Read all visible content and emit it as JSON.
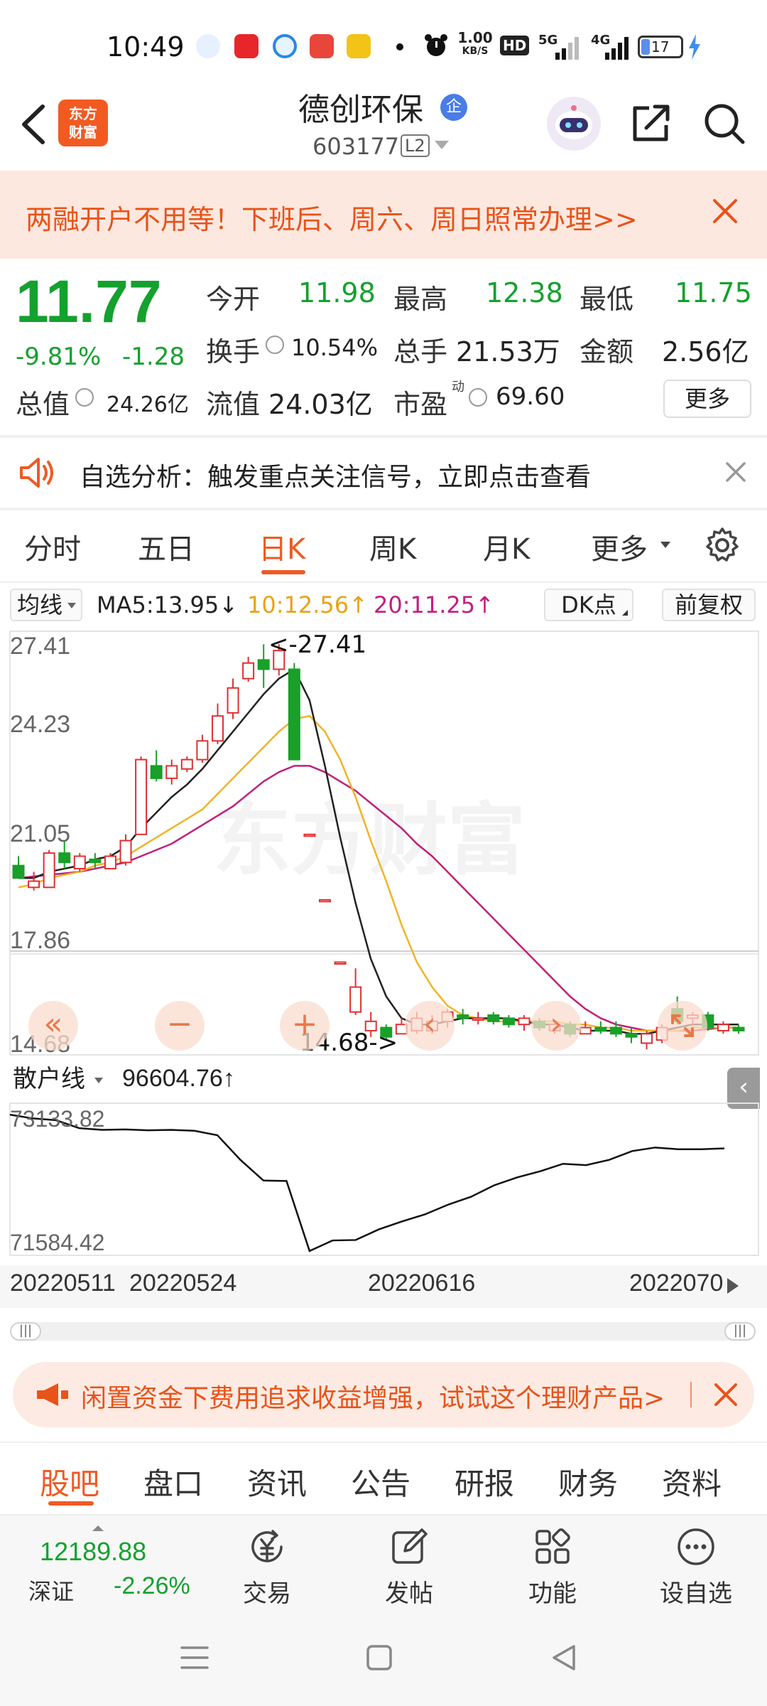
{
  "status_bar": {
    "time": "10:49",
    "net_speed": "1.00",
    "net_unit": "KB/S",
    "hd_label": "HD",
    "signal_5g": "5G",
    "signal_4g": "4G",
    "battery": "17"
  },
  "header": {
    "logo_line1": "东方",
    "logo_line2": "财富",
    "stock_name": "德创环保",
    "qiye_badge": "企",
    "stock_code": "603177",
    "level_badge": "L2"
  },
  "promo": {
    "text": "两融开户不用等！下班后、周六、周日照常办理>>"
  },
  "quote": {
    "price": "11.77",
    "change_pct": "-9.81%",
    "change": "-1.28",
    "open_label": "今开",
    "open": "11.98",
    "high_label": "最高",
    "high": "12.38",
    "low_label": "最低",
    "low": "11.75",
    "turnover_label": "换手",
    "turnover": "10.54%",
    "volume_label": "总手",
    "volume": "21.53万",
    "amount_label": "金额",
    "amount": "2.56亿",
    "mktcap_label": "总值",
    "mktcap": "24.26亿",
    "float_label": "流值",
    "float_cap": "24.03亿",
    "pe_label": "市盈",
    "pe_sup": "动",
    "pe": "69.60",
    "more_label": "更多"
  },
  "notice": {
    "text": "自选分析：触发重点关注信号，立即点击查看"
  },
  "period_tabs": [
    "分时",
    "五日",
    "日K",
    "周K",
    "月K",
    "更多"
  ],
  "active_period_index": 2,
  "chart_toolbar": {
    "ma_select": "均线",
    "ma5": "MA5:13.95",
    "ma5_arrow": "↓",
    "ma10": "10:12.56",
    "ma10_arrow": "↑",
    "ma20": "20:11.25",
    "ma20_arrow": "↑",
    "dk_label": "DK点",
    "adjust_label": "前复权"
  },
  "chart_watermark": "东方财富",
  "chart_data": {
    "type": "candlestick",
    "y_ticks": [
      "27.41",
      "24.23",
      "21.05",
      "17.86",
      "14.68"
    ],
    "ylim": [
      14.68,
      27.41
    ],
    "high_marker": "27.41",
    "low_marker": "14.68",
    "high_arrow": "<-",
    "low_arrow": "->",
    "x_labels": [
      "20220511",
      "20220524",
      "20220616",
      "2022070"
    ],
    "ma_colors": {
      "ma5": "#222222",
      "ma10": "#f0b429",
      "ma20": "#c0207a"
    },
    "up_color": "#e03030",
    "down_color": "#18a028",
    "candles": [
      {
        "o": 20.3,
        "h": 20.6,
        "l": 19.9,
        "c": 19.9
      },
      {
        "o": 19.6,
        "h": 20.1,
        "l": 19.5,
        "c": 19.8
      },
      {
        "o": 19.6,
        "h": 20.8,
        "l": 19.6,
        "c": 20.7
      },
      {
        "o": 20.7,
        "h": 21.1,
        "l": 20.2,
        "c": 20.4
      },
      {
        "o": 20.2,
        "h": 20.7,
        "l": 20.1,
        "c": 20.6
      },
      {
        "o": 20.5,
        "h": 20.7,
        "l": 20.2,
        "c": 20.4
      },
      {
        "o": 20.2,
        "h": 20.7,
        "l": 20.2,
        "c": 20.6
      },
      {
        "o": 20.4,
        "h": 21.3,
        "l": 20.3,
        "c": 21.1
      },
      {
        "o": 21.3,
        "h": 23.8,
        "l": 21.3,
        "c": 23.7
      },
      {
        "o": 23.5,
        "h": 24.0,
        "l": 23.0,
        "c": 23.1
      },
      {
        "o": 23.1,
        "h": 23.7,
        "l": 22.9,
        "c": 23.5
      },
      {
        "o": 23.4,
        "h": 23.8,
        "l": 23.3,
        "c": 23.7
      },
      {
        "o": 23.7,
        "h": 24.5,
        "l": 23.6,
        "c": 24.3
      },
      {
        "o": 24.3,
        "h": 25.5,
        "l": 24.2,
        "c": 25.1
      },
      {
        "o": 25.2,
        "h": 26.3,
        "l": 25.0,
        "c": 26.0
      },
      {
        "o": 26.3,
        "h": 27.0,
        "l": 26.2,
        "c": 26.8
      },
      {
        "o": 26.9,
        "h": 27.4,
        "l": 26.0,
        "c": 26.6
      },
      {
        "o": 26.6,
        "h": 27.41,
        "l": 26.4,
        "c": 27.2
      },
      {
        "o": 26.6,
        "h": 26.8,
        "l": 23.7,
        "c": 23.7
      },
      {
        "o": 21.3,
        "h": 21.3,
        "l": 21.3,
        "c": 21.3
      },
      {
        "o": 19.2,
        "h": 19.2,
        "l": 19.2,
        "c": 19.2
      },
      {
        "o": 17.2,
        "h": 17.2,
        "l": 17.2,
        "c": 17.2
      },
      {
        "o": 15.6,
        "h": 17.0,
        "l": 15.5,
        "c": 16.4
      },
      {
        "o": 15.0,
        "h": 15.6,
        "l": 14.8,
        "c": 15.3
      },
      {
        "o": 15.1,
        "h": 15.2,
        "l": 14.68,
        "c": 14.8
      },
      {
        "o": 14.9,
        "h": 15.4,
        "l": 14.9,
        "c": 15.2
      },
      {
        "o": 15.0,
        "h": 15.6,
        "l": 14.9,
        "c": 15.4
      },
      {
        "o": 15.0,
        "h": 15.5,
        "l": 14.9,
        "c": 15.3
      },
      {
        "o": 15.3,
        "h": 15.7,
        "l": 15.1,
        "c": 15.6
      },
      {
        "o": 15.5,
        "h": 15.7,
        "l": 15.2,
        "c": 15.4
      },
      {
        "o": 15.4,
        "h": 15.6,
        "l": 15.2,
        "c": 15.4
      },
      {
        "o": 15.5,
        "h": 15.6,
        "l": 15.2,
        "c": 15.3
      },
      {
        "o": 15.4,
        "h": 15.5,
        "l": 15.1,
        "c": 15.2
      },
      {
        "o": 15.2,
        "h": 15.5,
        "l": 15.0,
        "c": 15.4
      },
      {
        "o": 15.3,
        "h": 15.4,
        "l": 15.0,
        "c": 15.1
      },
      {
        "o": 15.0,
        "h": 15.3,
        "l": 14.9,
        "c": 15.2
      },
      {
        "o": 15.2,
        "h": 15.3,
        "l": 14.8,
        "c": 14.9
      },
      {
        "o": 14.9,
        "h": 15.3,
        "l": 14.9,
        "c": 15.1
      },
      {
        "o": 15.1,
        "h": 15.3,
        "l": 14.9,
        "c": 15.0
      },
      {
        "o": 15.1,
        "h": 15.3,
        "l": 14.8,
        "c": 14.9
      },
      {
        "o": 14.9,
        "h": 15.1,
        "l": 14.6,
        "c": 14.8
      },
      {
        "o": 14.6,
        "h": 15.0,
        "l": 14.4,
        "c": 14.9
      },
      {
        "o": 14.7,
        "h": 15.2,
        "l": 14.6,
        "c": 15.1
      },
      {
        "o": 15.7,
        "h": 16.1,
        "l": 15.2,
        "c": 15.3
      },
      {
        "o": 15.4,
        "h": 15.6,
        "l": 15.2,
        "c": 15.5
      },
      {
        "o": 15.5,
        "h": 15.6,
        "l": 15.0,
        "c": 15.1
      },
      {
        "o": 15.0,
        "h": 15.3,
        "l": 14.9,
        "c": 15.2
      },
      {
        "o": 15.1,
        "h": 15.2,
        "l": 14.9,
        "c": 15.0
      }
    ],
    "ma5": [
      19.9,
      19.9,
      20.1,
      20.2,
      20.3,
      20.5,
      20.6,
      20.9,
      21.5,
      22.0,
      22.5,
      22.9,
      23.4,
      24.0,
      24.6,
      25.2,
      25.8,
      26.3,
      26.6,
      25.6,
      23.5,
      21.2,
      19.1,
      17.3,
      16.1,
      15.4,
      15.2,
      15.2,
      15.3,
      15.4,
      15.4,
      15.4,
      15.4,
      15.3,
      15.2,
      15.2,
      15.1,
      15.0,
      15.0,
      15.0,
      14.9,
      14.9,
      15.0,
      15.1,
      15.2,
      15.2,
      15.2,
      15.2
    ],
    "ma10": [
      19.6,
      19.7,
      19.9,
      20.0,
      20.1,
      20.3,
      20.4,
      20.6,
      20.9,
      21.2,
      21.5,
      21.8,
      22.1,
      22.6,
      23.1,
      23.6,
      24.1,
      24.6,
      25.0,
      25.1,
      24.6,
      23.7,
      22.5,
      21.1,
      19.8,
      18.4,
      17.2,
      16.4,
      15.8,
      15.5,
      15.4,
      15.3,
      15.3,
      15.3,
      15.3,
      15.3,
      15.2,
      15.2,
      15.1,
      15.1,
      15.0,
      15.0,
      15.0,
      15.0,
      15.1,
      15.1,
      15.1,
      15.1
    ],
    "ma20": [
      19.9,
      19.95,
      20.0,
      20.05,
      20.1,
      20.2,
      20.3,
      20.4,
      20.6,
      20.8,
      21.0,
      21.3,
      21.6,
      21.9,
      22.2,
      22.6,
      23.0,
      23.3,
      23.5,
      23.5,
      23.3,
      23.0,
      22.7,
      22.3,
      21.9,
      21.5,
      21.0,
      20.6,
      20.1,
      19.6,
      19.1,
      18.6,
      18.1,
      17.6,
      17.1,
      16.6,
      16.1,
      15.7,
      15.4,
      15.2,
      15.1,
      15.0,
      15.0,
      15.0,
      15.0,
      15.05,
      15.1,
      15.1
    ]
  },
  "indicator": {
    "select_label": "散户线",
    "value": "96604.76",
    "value_arrow": "↑",
    "y_top": "73133.82",
    "y_bottom": "71584.42",
    "collapse_icon": "‹",
    "series": [
      73133,
      73090,
      73070,
      72980,
      72960,
      72965,
      72955,
      72960,
      72950,
      72900,
      72620,
      72385,
      72380,
      71585,
      71705,
      71710,
      71830,
      71920,
      72000,
      72110,
      72200,
      72330,
      72420,
      72490,
      72575,
      72560,
      72620,
      72720,
      72760,
      72740,
      72740,
      72750
    ]
  },
  "scroller": {
    "left_handle": "|||",
    "right_handle": "|||"
  },
  "ad": {
    "text": "闲置资金下费用追求收益增强，试试这个理财产品>"
  },
  "bottom_tabs": [
    "股吧",
    "盘口",
    "资讯",
    "公告",
    "研报",
    "财务",
    "资料"
  ],
  "active_bottom_tab": 0,
  "bottom_toolbar": {
    "index_value": "12189.88",
    "index_name": "深证",
    "index_pct": "-2.26%",
    "tools": [
      "交易",
      "发帖",
      "功能",
      "设自选"
    ]
  },
  "controls": {
    "rewind": "«",
    "zoom_out": "−",
    "zoom_in": "+",
    "prev": "‹",
    "next": "›"
  }
}
